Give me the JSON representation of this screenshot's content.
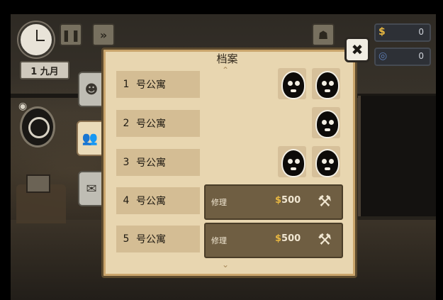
{
  "hud": {
    "date": "1 九月",
    "pause_icon": "pause-icon",
    "fastforward_icon": "fast-forward-icon",
    "money_icon": "$",
    "money": "0",
    "reputation_icon": "◎",
    "reputation": "0"
  },
  "panel": {
    "title": "档案",
    "tabs": [
      {
        "icon": "tenant-ghost-icon",
        "active": false
      },
      {
        "icon": "people-icon",
        "active": true
      },
      {
        "icon": "document-icon",
        "active": false
      }
    ],
    "rows": [
      {
        "number": "1",
        "name": "号公寓",
        "tenants": 2
      },
      {
        "number": "2",
        "name": "号公寓",
        "tenants": 1
      },
      {
        "number": "3",
        "name": "号公寓",
        "tenants": 2
      },
      {
        "number": "4",
        "name": "号公寓",
        "repair_label": "修理",
        "price": "500"
      },
      {
        "number": "5",
        "name": "号公寓",
        "repair_label": "修理",
        "price": "500"
      }
    ]
  },
  "colors": {
    "panel_bg": "#e8d6b0",
    "repair_bg": "#6f5e42",
    "money_gold": "#e6b640"
  }
}
